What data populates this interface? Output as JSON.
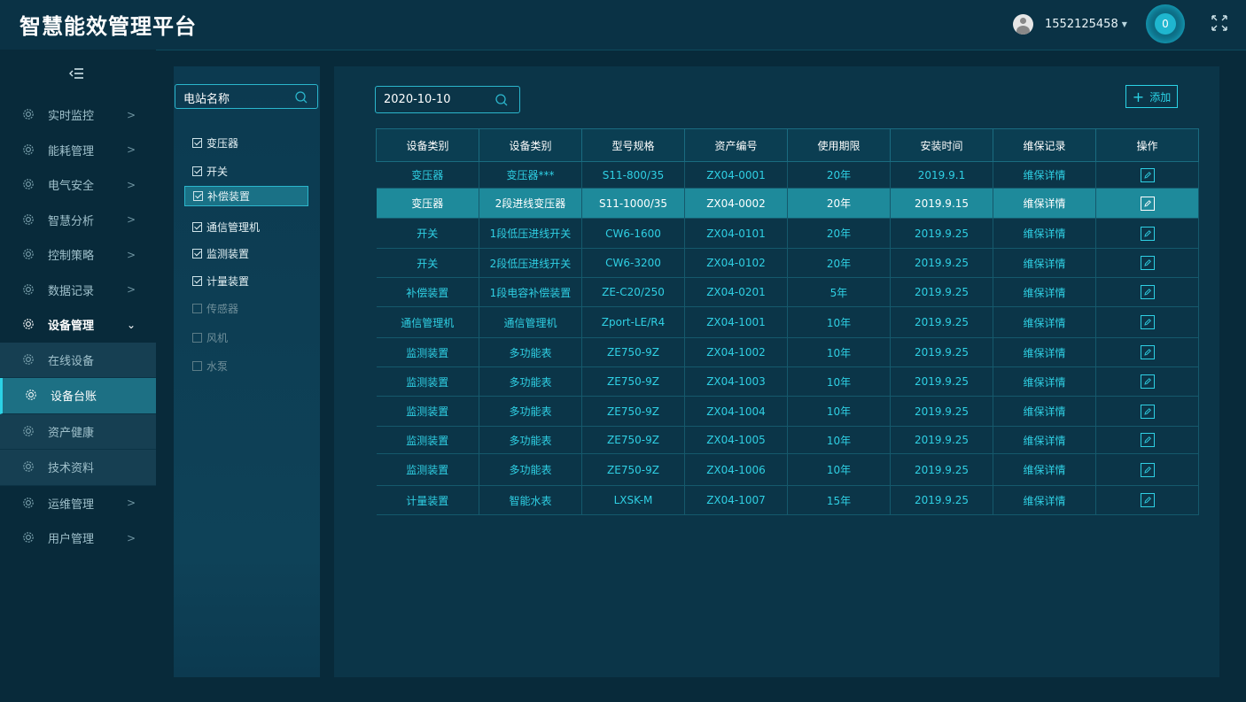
{
  "app": {
    "title": "智慧能效管理平台"
  },
  "header": {
    "username": "1552125458",
    "notification_count": "0"
  },
  "sidebar": {
    "items": [
      {
        "label": "实时监控",
        "arrow": ">"
      },
      {
        "label": "能耗管理",
        "arrow": ">"
      },
      {
        "label": "电气安全",
        "arrow": ">"
      },
      {
        "label": "智慧分析",
        "arrow": ">"
      },
      {
        "label": "控制策略",
        "arrow": ">"
      },
      {
        "label": "数据记录",
        "arrow": ">"
      },
      {
        "label": "设备管理",
        "arrow": "⌄"
      },
      {
        "label": "在线设备"
      },
      {
        "label": "设备台账"
      },
      {
        "label": "资产健康"
      },
      {
        "label": "技术资料"
      },
      {
        "label": "运维管理",
        "arrow": ">"
      },
      {
        "label": "用户管理",
        "arrow": ">"
      }
    ]
  },
  "filter": {
    "search_text": "电站名称",
    "options": [
      {
        "label": "变压器",
        "checked": true
      },
      {
        "label": "开关",
        "checked": true
      },
      {
        "label": "补偿装置",
        "checked": true
      },
      {
        "label": "通信管理机",
        "checked": true
      },
      {
        "label": "监测装置",
        "checked": true
      },
      {
        "label": "计量装置",
        "checked": true
      },
      {
        "label": "传感器",
        "checked": false
      },
      {
        "label": "风机",
        "checked": false
      },
      {
        "label": "水泵",
        "checked": false
      }
    ]
  },
  "toolbar": {
    "date": "2020-10-10",
    "add_label": "添加",
    "add_symbol": "+"
  },
  "table": {
    "headers": [
      "设备类别",
      "设备类别",
      "型号规格",
      "资产编号",
      "使用期限",
      "安装时间",
      "维保记录",
      "操作"
    ],
    "rows": [
      [
        "变压器",
        "变压器***",
        "S11-800/35",
        "ZX04-0001",
        "20年",
        "2019.9.1",
        "维保详情"
      ],
      [
        "变压器",
        "2段进线变压器",
        "S11-1000/35",
        "ZX04-0002",
        "20年",
        "2019.9.15",
        "维保详情"
      ],
      [
        "开关",
        "1段低压进线开关",
        "CW6-1600",
        "ZX04-0101",
        "20年",
        "2019.9.25",
        "维保详情"
      ],
      [
        "开关",
        "2段低压进线开关",
        "CW6-3200",
        "ZX04-0102",
        "20年",
        "2019.9.25",
        "维保详情"
      ],
      [
        "补偿装置",
        "1段电容补偿装置",
        "ZE-C20/250",
        "ZX04-0201",
        "5年",
        "2019.9.25",
        "维保详情"
      ],
      [
        "通信管理机",
        "通信管理机",
        "Zport-LE/R4",
        "ZX04-1001",
        "10年",
        "2019.9.25",
        "维保详情"
      ],
      [
        "监测装置",
        "多功能表",
        "ZE750-9Z",
        "ZX04-1002",
        "10年",
        "2019.9.25",
        "维保详情"
      ],
      [
        "监测装置",
        "多功能表",
        "ZE750-9Z",
        "ZX04-1003",
        "10年",
        "2019.9.25",
        "维保详情"
      ],
      [
        "监测装置",
        "多功能表",
        "ZE750-9Z",
        "ZX04-1004",
        "10年",
        "2019.9.25",
        "维保详情"
      ],
      [
        "监测装置",
        "多功能表",
        "ZE750-9Z",
        "ZX04-1005",
        "10年",
        "2019.9.25",
        "维保详情"
      ],
      [
        "监测装置",
        "多功能表",
        "ZE750-9Z",
        "ZX04-1006",
        "10年",
        "2019.9.25",
        "维保详情"
      ],
      [
        "计量装置",
        "智能水表",
        "LXSK-M",
        "ZX04-1007",
        "15年",
        "2019.9.25",
        "维保详情"
      ]
    ]
  },
  "colors": {
    "accent": "#2bd3e6",
    "row_highlight": "#1e8a9b",
    "background": "#082a3a"
  }
}
